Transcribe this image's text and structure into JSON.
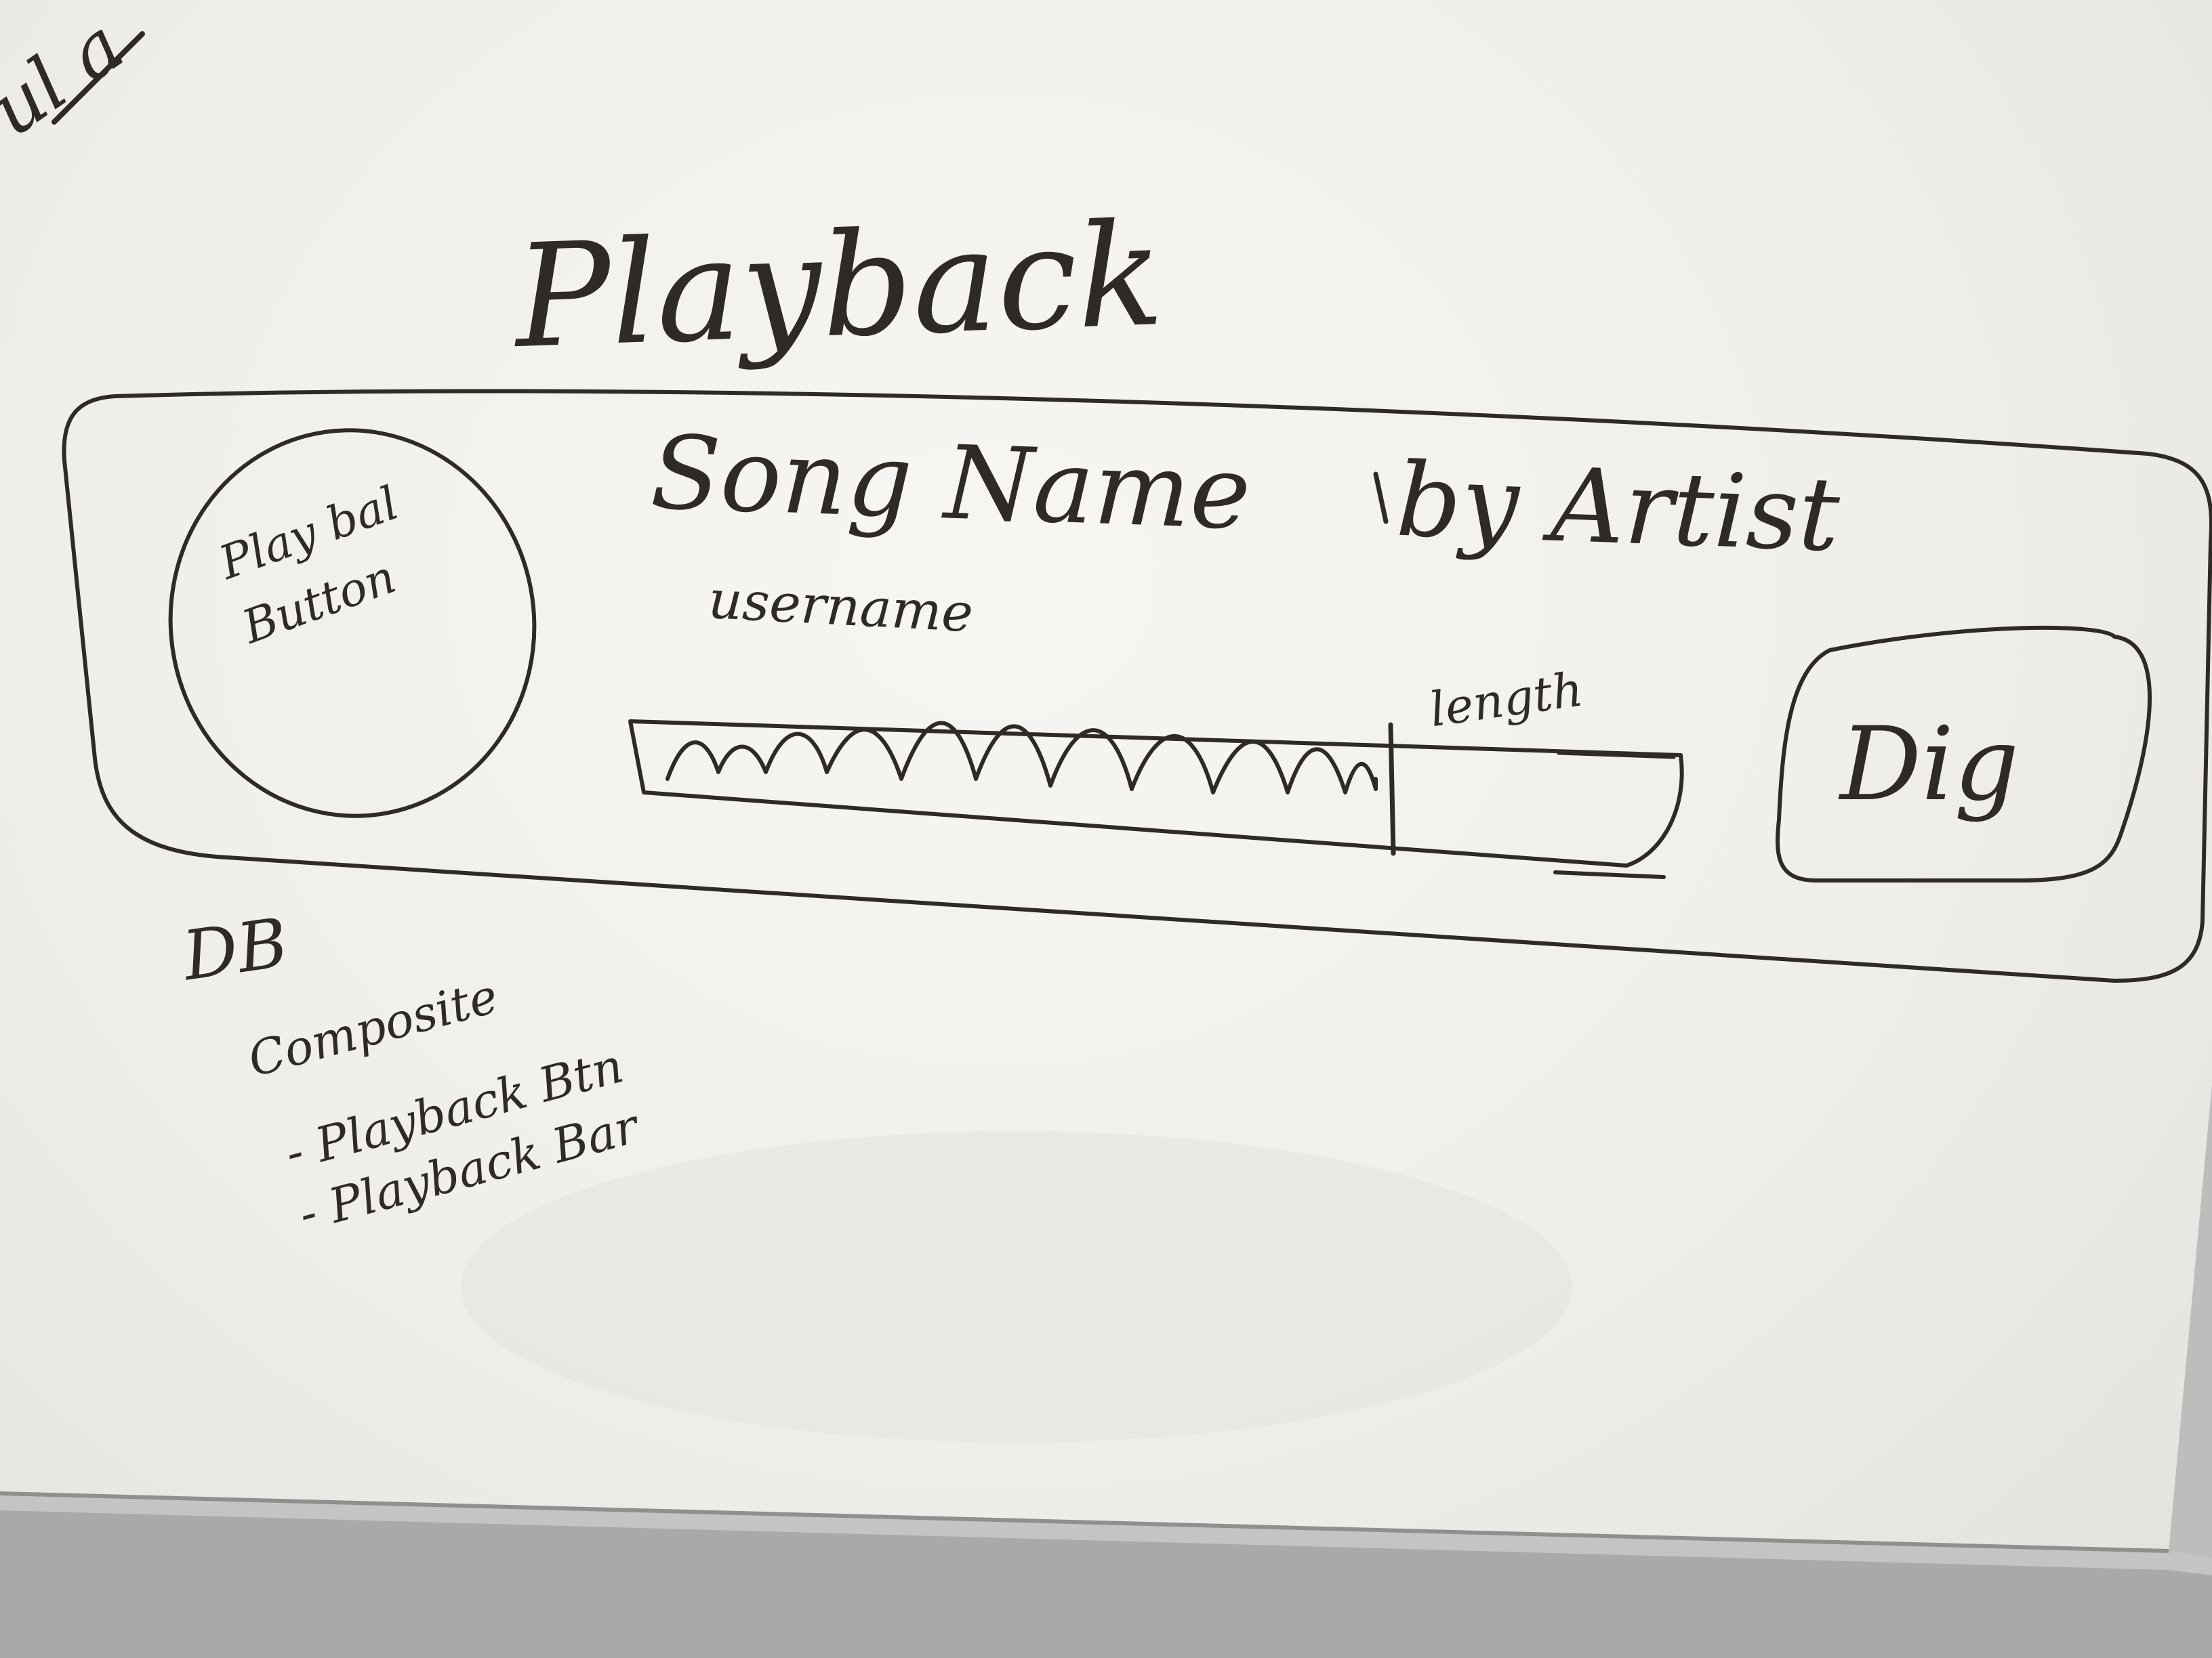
{
  "diagram": {
    "title": "Playback",
    "play_button_label": [
      "Play bal",
      "Button"
    ],
    "song_name": "Song Name",
    "by_artist": "by Artist",
    "username": "username",
    "length_label": "length",
    "dig_button": "Dig",
    "notes": [
      "DB",
      "Composite",
      "- Playback Btn",
      "- Playback Bar"
    ],
    "corner_fragment": "ul a"
  },
  "colors": {
    "ink": "#2f2a26",
    "board": "#f4f3f0",
    "tray": "#b9bab8"
  }
}
